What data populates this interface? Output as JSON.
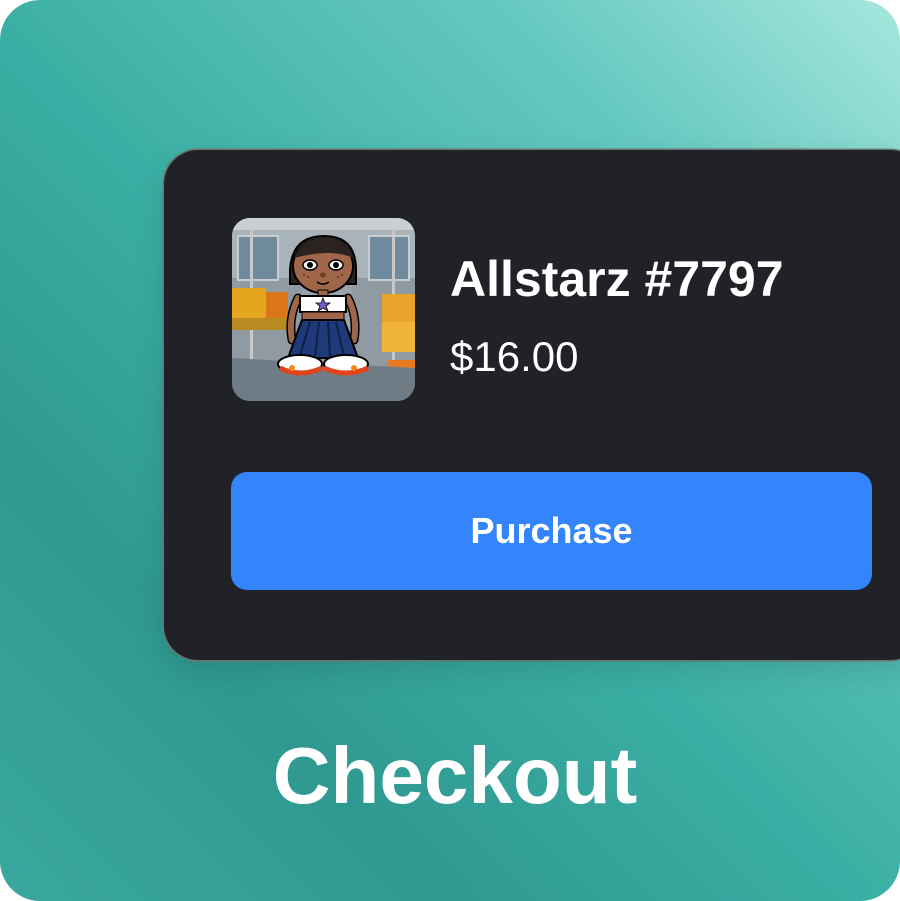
{
  "screen": {
    "caption": "Checkout"
  },
  "item": {
    "name": "Allstarz #7797",
    "price": "$16.00",
    "image_icon": "nft-avatar-character"
  },
  "actions": {
    "purchase_label": "Purchase"
  },
  "colors": {
    "background_gradient_light": "#a6e6de",
    "background_gradient_dark": "#2f9990",
    "card": "#212228",
    "button": "#3485fc",
    "text": "#ffffff"
  }
}
